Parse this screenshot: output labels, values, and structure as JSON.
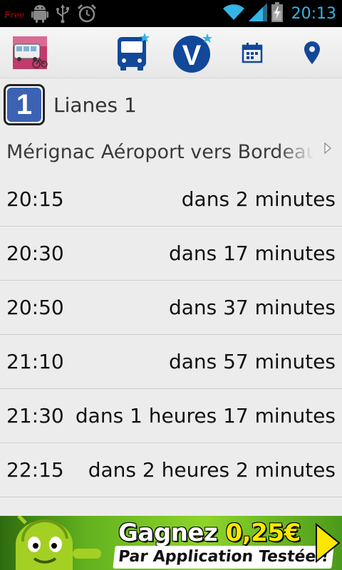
{
  "status_bar": {
    "carrier_logo": "Free",
    "time": "20:13",
    "icons": [
      "android-icon",
      "usb-icon",
      "alarm-icon",
      "wifi-icon",
      "signal-icon",
      "battery-icon"
    ]
  },
  "action_bar": {
    "icons": [
      "app-logo-icon",
      "bus-icon",
      "v-logo-icon",
      "calendar-icon",
      "location-pin-icon"
    ]
  },
  "line": {
    "number": "1",
    "name": "Lianes 1"
  },
  "direction": "Mérignac Aéroport vers Bordeaux",
  "departures": [
    {
      "time": "20:15",
      "until": "dans 2 minutes"
    },
    {
      "time": "20:30",
      "until": "dans 17 minutes"
    },
    {
      "time": "20:50",
      "until": "dans 37 minutes"
    },
    {
      "time": "21:10",
      "until": "dans 57 minutes"
    },
    {
      "time": "21:30",
      "until": "dans 1 heures 17 minutes"
    },
    {
      "time": "22:15",
      "until": "dans 2 heures 2 minutes"
    }
  ],
  "ad": {
    "headline": "Gagnez",
    "amount": "0,25€",
    "subline": "Par Application Testée !"
  },
  "colors": {
    "accent": "#33b5e5",
    "line_badge": "#3c62b3",
    "brand_blue": "#12479a"
  }
}
